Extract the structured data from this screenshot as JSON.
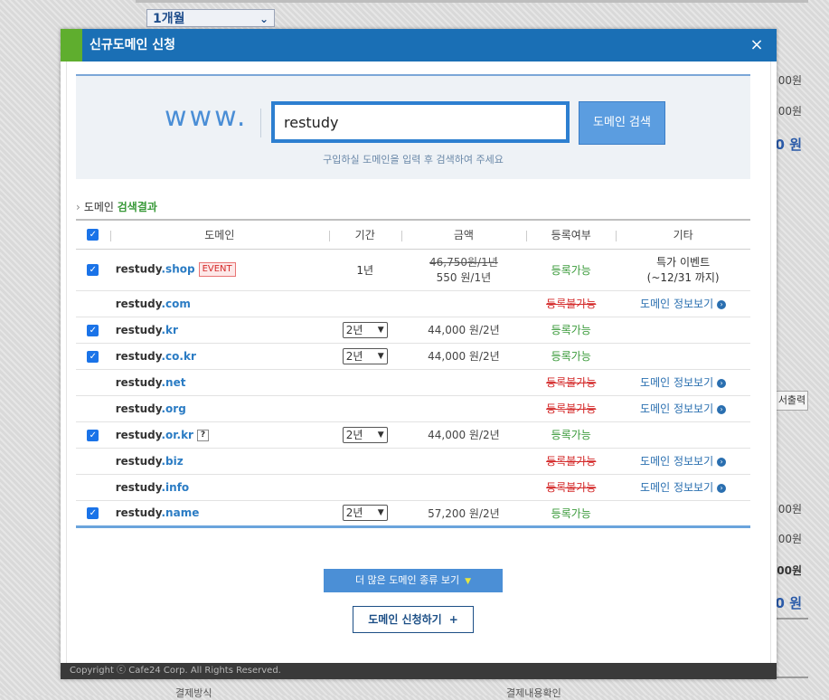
{
  "background": {
    "period_select": "1개월",
    "prices": [
      "00원",
      "00원",
      "0 원",
      "00원",
      "00원",
      "00원",
      "0 원"
    ],
    "print_btn": "서출력",
    "footer_left": "결제방식",
    "footer_right": "결제내용확인"
  },
  "modal": {
    "title": "신규도메인 신청",
    "close_icon": "×",
    "footer": "Copyright ⓒ Cafe24 Corp. All Rights Reserved."
  },
  "search": {
    "prefix": "www.",
    "value": "restudy",
    "button": "도메인 검색",
    "hint": "구입하실 도메인을 입력 후 검색하여 주세요"
  },
  "results": {
    "heading_prefix": "도메인",
    "heading_highlight": "검색결과",
    "columns": {
      "domain": "도메인",
      "period": "기간",
      "price": "금액",
      "status": "등록여부",
      "etc": "기타"
    },
    "rows": [
      {
        "name": "restudy",
        "ext": ".shop",
        "badge": "EVENT",
        "period": "1년",
        "price_old": "46,750원/1년",
        "price": "550 원/1년",
        "status": "등록가능",
        "etc1": "특가 이벤트",
        "etc2": "(~12/31 까지)"
      },
      {
        "name": "restudy",
        "ext": ".com",
        "status": "등록불가능",
        "info": "도메인 정보보기"
      },
      {
        "name": "restudy",
        "ext": ".kr",
        "period": "2년",
        "price": "44,000 원/2년",
        "status": "등록가능"
      },
      {
        "name": "restudy",
        "ext": ".co.kr",
        "period": "2년",
        "price": "44,000 원/2년",
        "status": "등록가능"
      },
      {
        "name": "restudy",
        "ext": ".net",
        "status": "등록불가능",
        "info": "도메인 정보보기"
      },
      {
        "name": "restudy",
        "ext": ".org",
        "status": "등록불가능",
        "info": "도메인 정보보기"
      },
      {
        "name": "restudy",
        "ext": ".or.kr",
        "period": "2년",
        "price": "44,000 원/2년",
        "status": "등록가능",
        "help": "?"
      },
      {
        "name": "restudy",
        "ext": ".biz",
        "status": "등록불가능",
        "info": "도메인 정보보기"
      },
      {
        "name": "restudy",
        "ext": ".info",
        "status": "등록불가능",
        "info": "도메인 정보보기"
      },
      {
        "name": "restudy",
        "ext": ".name",
        "period": "2년",
        "price": "57,200 원/2년",
        "status": "등록가능"
      }
    ],
    "more_button": "더 많은 도메인 종류 보기",
    "apply_button": "도메인 신청하기",
    "apply_plus": "+"
  },
  "colors": {
    "header": "#1a6fb5",
    "accent": "#5fae2e",
    "available": "#3a9a3a",
    "unavailable": "#d42a2a"
  }
}
